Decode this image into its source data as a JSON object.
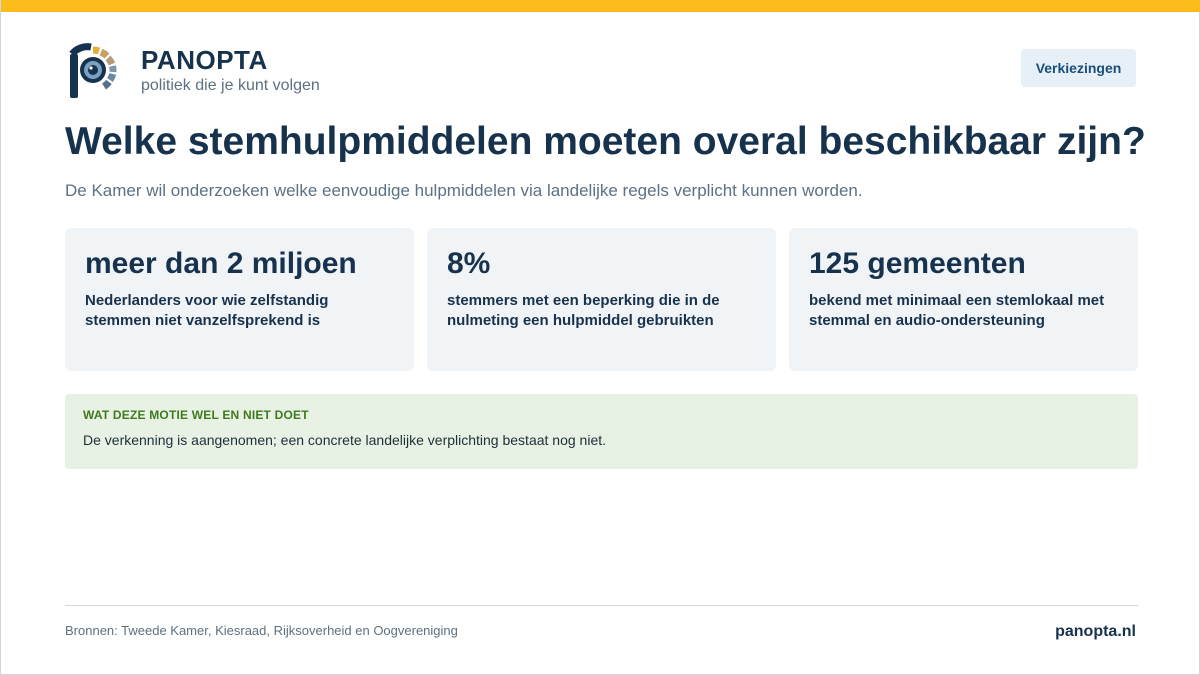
{
  "brand": {
    "name": "PANOPTA",
    "tagline": "politiek die je kunt volgen",
    "logo_icon": "panopta-eye-logo-icon"
  },
  "nav": {
    "elections_label": "Verkiezingen"
  },
  "headline": {
    "title": "Welke stemhulpmiddelen moeten overal beschikbaar zijn?",
    "subtitle": "De Kamer wil onderzoeken welke eenvoudige hulpmiddelen via landelijke regels verplicht kunnen worden."
  },
  "stats": [
    {
      "value": "meer dan 2 miljoen",
      "label": "Nederlanders voor wie zelfstandig stemmen niet vanzelfsprekend is"
    },
    {
      "value": "8%",
      "label": "stemmers met een beperking die in de nulmeting een hulpmiddel gebruikten"
    },
    {
      "value": "125 gemeenten",
      "label": "bekend met minimaal een stemlokaal met stemmal en audio-ondersteuning"
    }
  ],
  "notice": {
    "heading": "WAT DEZE MOTIE WEL EN NIET DOET",
    "text": "De verkenning is aangenomen; een concrete landelijke verplichting bestaat nog niet."
  },
  "footer": {
    "sources": "Bronnen: Tweede Kamer, Kiesraad, Rijksoverheid en Oogvereniging",
    "site": "panopta.nl"
  },
  "colors": {
    "accent_bar": "#fbbc1c",
    "navy": "#17324d",
    "muted_text": "#5d7183",
    "card_bg": "#f1f4f7",
    "notice_bg": "#e8f2e4",
    "notice_heading": "#3f7a1f"
  }
}
